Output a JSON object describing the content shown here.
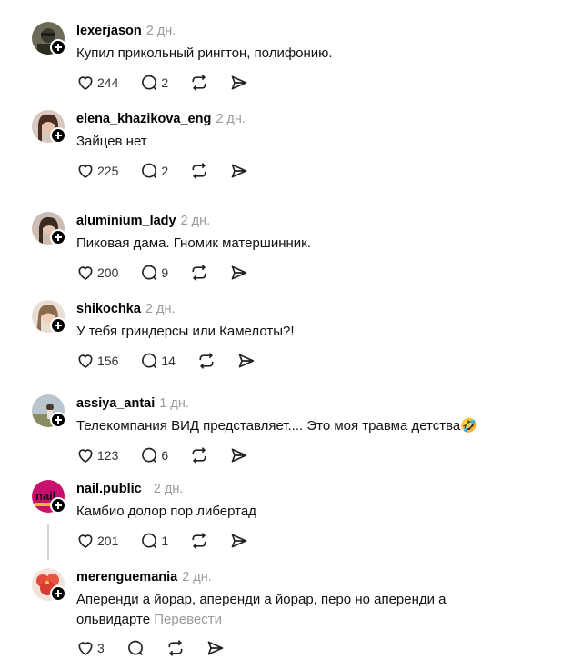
{
  "comments": [
    {
      "username": "lexerjason",
      "time": "2 дн.",
      "text": "Купил прикольный рингтон, полифонию.",
      "likes": "244",
      "replies": "2",
      "avatar_color": "#4a4a3c"
    },
    {
      "username": "elena_khazikova_eng",
      "time": "2 дн.",
      "text": "Зайцев нет",
      "likes": "225",
      "replies": "2",
      "avatar_color": "#7a5a4e"
    },
    {
      "username": "aluminium_lady",
      "time": "2 дн.",
      "text": "Пиковая дама. Гномик матершинник.",
      "likes": "200",
      "replies": "9",
      "avatar_color": "#9b8878"
    },
    {
      "username": "shikochka",
      "time": "2 дн.",
      "text": "У тебя гриндерсы или Камелоты?!",
      "likes": "156",
      "replies": "14",
      "avatar_color": "#b89a7e"
    },
    {
      "username": "assiya_antai",
      "time": "1 дн.",
      "text": "Телекомпания ВИД представляет.... Это моя травма детства🤣",
      "likes": "123",
      "replies": "6",
      "avatar_color": "#7d8f6e"
    },
    {
      "username": "nail.public_",
      "time": "2 дн.",
      "text": "Камбио долор пор либертад",
      "likes": "201",
      "replies": "1",
      "avatar_color": "#c8106e"
    },
    {
      "username": "merenguemania",
      "time": "2 дн.",
      "text": "Аперенди а йорар, аперенди а йорар, перо но аперенди а ольвидарте",
      "translate": "Перевести",
      "likes": "3",
      "replies": "",
      "avatar_color": "#e24a3a"
    }
  ]
}
